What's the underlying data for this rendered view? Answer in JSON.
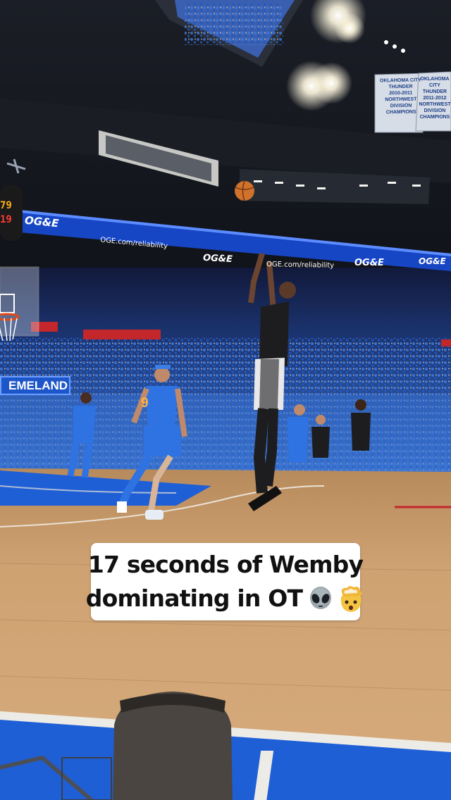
{
  "caption": {
    "line1": "17 seconds of Wemby",
    "line2": "dominating in OT",
    "emojis": [
      "alien-emoji",
      "exploding-head-emoji"
    ]
  },
  "ribbon": {
    "brand": "OG&E",
    "url": "OGE.com/reliability"
  },
  "side_sign": {
    "text": "EMELAND"
  },
  "shot_clock": {
    "top": "79",
    "bottom": "19"
  },
  "jersey": {
    "number": "9"
  },
  "banners": [
    {
      "lines": [
        "OKLAHOMA CITY",
        "THUNDER",
        "2010-2011",
        "NORTHWEST",
        "DIVISION",
        "CHAMPIONS"
      ]
    },
    {
      "lines": [
        "OKLAHOMA CITY",
        "THUNDER",
        "2011-2012",
        "NORTHWEST",
        "DIVISION",
        "CHAMPIONS"
      ]
    }
  ],
  "colors": {
    "court_wood": "#c99a69",
    "court_paint": "#1f5fd6",
    "crowd_blue": "#2d6fd1",
    "ribbon_blue": "#1746c4",
    "caption_bg": "#ffffff",
    "caption_text": "#111111"
  }
}
